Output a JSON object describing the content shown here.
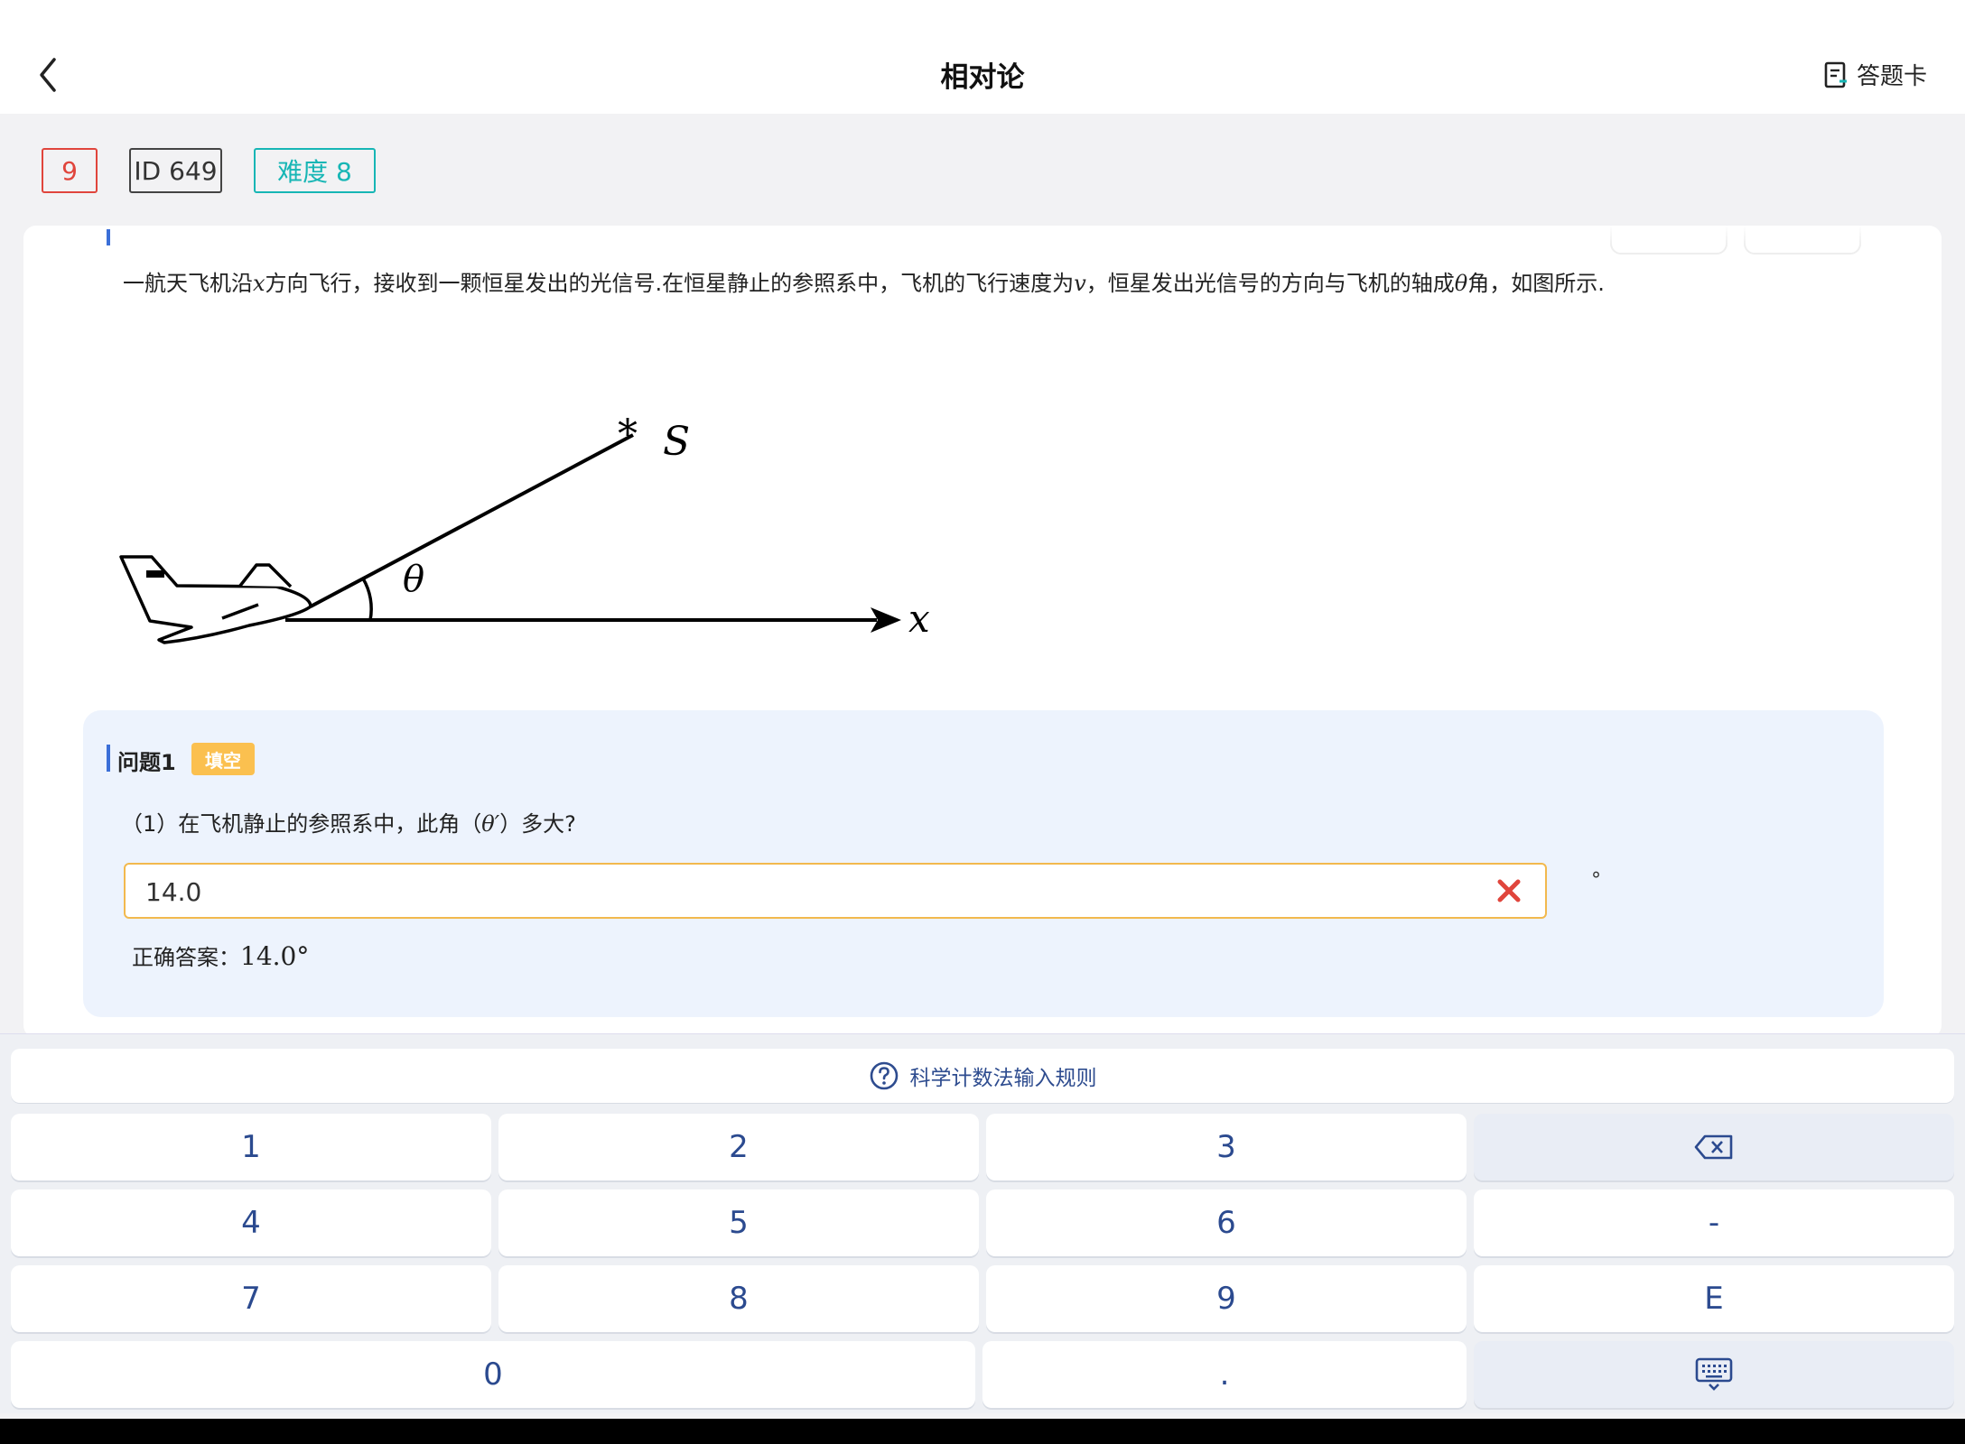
{
  "header": {
    "title": "相对论",
    "answer_card_label": "答题卡"
  },
  "tags": {
    "number": "9",
    "id": "ID 649",
    "difficulty": "难度 8"
  },
  "problem": {
    "text_before_x": "一航天飞机沿",
    "var_x": "x",
    "text_after_x": "方向飞行，接收到一颗恒星发出的光信号.在恒星静止的参照系中，飞机的飞行速度为",
    "var_v": "v",
    "text_after_v": "，恒星发出光信号的方向与飞机的轴成",
    "var_theta": "θ",
    "text_end": "角，如图所示.",
    "figure": {
      "star_label": "S",
      "angle_label": "θ",
      "axis_label": "x"
    }
  },
  "question": {
    "title": "问题1",
    "type_badge": "填空",
    "text_before": "（1）在飞机静止的参照系中，此角（",
    "var": "θ′",
    "text_after": "）多大?",
    "input_value": "14.0",
    "unit": "°",
    "correct_label": "正确答案：",
    "correct_value": "14.0°"
  },
  "keypad": {
    "sci_rule_label": "科学计数法输入规则",
    "keys": [
      "1",
      "2",
      "3",
      "4",
      "5",
      "6",
      "-",
      "7",
      "8",
      "9",
      "E",
      "0",
      "."
    ]
  },
  "icons": {
    "back": "chevron-left-icon",
    "answer_card": "answer-sheet-icon",
    "wrong": "close-icon",
    "help": "question-circle-icon",
    "backspace": "backspace-icon",
    "hide_keyboard": "keyboard-hide-icon"
  },
  "colors": {
    "accent_blue": "#3b6fd8",
    "error_red": "#e0453c",
    "difficulty_teal": "#17b6b5",
    "badge_yellow": "#fbc04f",
    "input_border": "#f2b94e",
    "key_text": "#2b4a8f"
  }
}
